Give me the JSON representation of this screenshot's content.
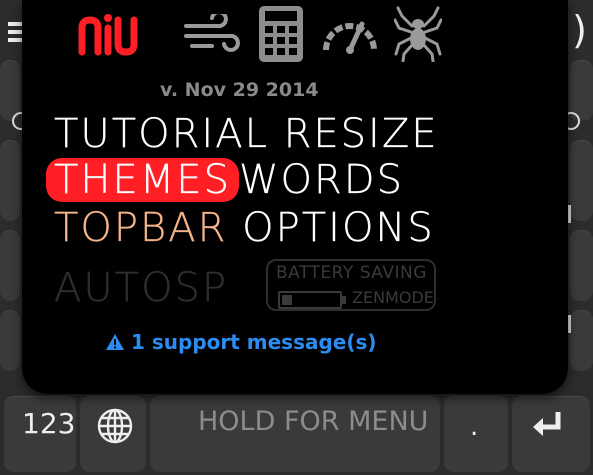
{
  "version": "v. Nov 29 2014",
  "menu": {
    "row1": [
      "TUTORIAL",
      "RESIZE"
    ],
    "row2": [
      "THEMES",
      "WORDS"
    ],
    "row3": [
      "TOPBAR",
      "OPTIONS"
    ],
    "autosp": "AUTOSP",
    "battery_line1": "BATTERY SAVING",
    "battery_line2": "ZENMODE"
  },
  "support": "1 support message(s)",
  "keyboard": {
    "numbers_key": "123",
    "hint": "HOLD FOR MENU",
    "period_key": "."
  },
  "icons": [
    "logo-icon",
    "wind-icon",
    "calculator-icon",
    "speedometer-icon",
    "spider-icon",
    "globe-icon",
    "enter-icon",
    "warning-icon"
  ],
  "colors": {
    "accent_red": "#ff1f24",
    "topbar_peach": "#f5b38a",
    "support_blue": "#2b8cf2",
    "panel_bg": "#000000",
    "muted_gray": "#8a8a8a"
  }
}
